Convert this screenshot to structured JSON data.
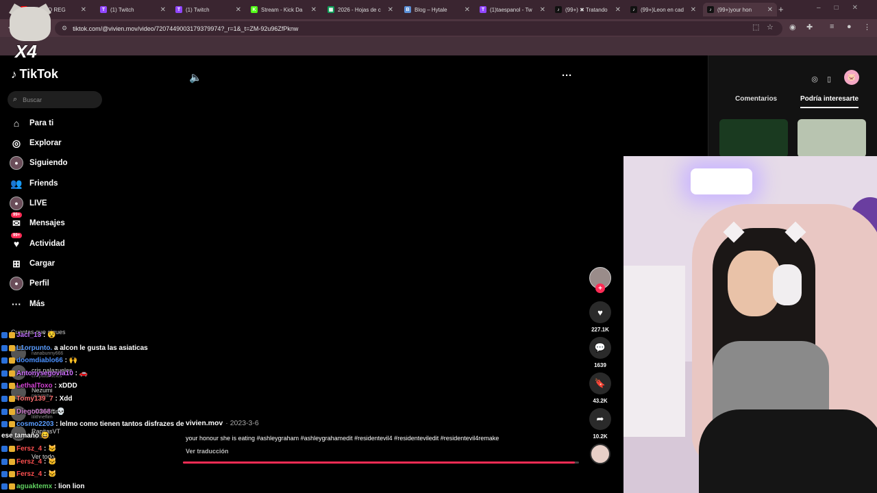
{
  "browser": {
    "tabs": [
      {
        "label": "(35) ¡NO REG",
        "icon": "youtube-icon",
        "color": "#ff0000",
        "glyph": "▶"
      },
      {
        "label": "(1) Twitch",
        "icon": "twitch-icon",
        "color": "#9146ff",
        "glyph": "T"
      },
      {
        "label": "(1) Twitch",
        "icon": "twitch-icon",
        "color": "#9146ff",
        "glyph": "T"
      },
      {
        "label": "Stream - Kick Da",
        "icon": "kick-icon",
        "color": "#53fc18",
        "glyph": "K"
      },
      {
        "label": "2026 - Hojas de c",
        "icon": "sheets-icon",
        "color": "#0f9d58",
        "glyph": "▦"
      },
      {
        "label": "Blog – Hytale",
        "icon": "hytale-icon",
        "color": "#5b8fd6",
        "glyph": "B"
      },
      {
        "label": "(1)taespanol - Tw",
        "icon": "twitch-icon",
        "color": "#9146ff",
        "glyph": "T"
      },
      {
        "label": "(99+) ✖ Tratando",
        "icon": "tiktok-icon",
        "color": "#111111",
        "glyph": "♪"
      },
      {
        "label": "(99+)Leon en cad",
        "icon": "tiktok-icon",
        "color": "#111111",
        "glyph": "♪"
      },
      {
        "label": "(99+)your hon",
        "icon": "tiktok-icon",
        "color": "#111111",
        "glyph": "♪"
      }
    ],
    "url": "tiktok.com/@vivien.mov/video/7207449003179379974?_r=1&_t=ZM-92u96ZfPknw",
    "overlay_multiplier": "X4"
  },
  "sidebar": {
    "logo": "TikTok",
    "search_placeholder": "Buscar",
    "nav": [
      {
        "label": "Para ti",
        "icon": "home-icon",
        "glyph": "⌂"
      },
      {
        "label": "Explorar",
        "icon": "compass-icon",
        "glyph": "◎"
      },
      {
        "label": "Siguiendo",
        "icon": "following-avatar-icon",
        "glyph": "●"
      },
      {
        "label": "Friends",
        "icon": "friends-icon",
        "glyph": "👥"
      },
      {
        "label": "LIVE",
        "icon": "live-icon",
        "glyph": "●"
      },
      {
        "label": "Mensajes",
        "icon": "messages-icon",
        "glyph": "✉",
        "badge": "99+"
      },
      {
        "label": "Actividad",
        "icon": "activity-icon",
        "glyph": "♥",
        "badge": "99+"
      },
      {
        "label": "Cargar",
        "icon": "upload-icon",
        "glyph": "⊞"
      },
      {
        "label": "Perfil",
        "icon": "profile-icon",
        "glyph": "●"
      },
      {
        "label": "Más",
        "icon": "more-icon",
        "glyph": "···"
      }
    ],
    "following_header": "Cuentas que sigues",
    "following": [
      {
        "name": "",
        "sub": "nanabunny666"
      },
      {
        "name": "cris.palazuelos",
        "sub": "crispalazuelos"
      },
      {
        "name": "Nezumi",
        "sub": "nezumitv"
      },
      {
        "name": "Lilithneflim",
        "sub": "lilithneflim"
      },
      {
        "name": "RapitasVT",
        "sub": "rapitasvt"
      }
    ],
    "see_all": "Ver todo"
  },
  "video": {
    "volume_icon": "volume-icon",
    "author": "vivien.mov",
    "date": "2023-3-6",
    "caption": "your honour she is eating #ashleygraham #ashleygrahamedit #residentevil4 #residenteviledit #residentevil4remake",
    "translate": "Ver traducción",
    "progress": 0.99,
    "likes": "227.1K",
    "comments": "1639",
    "saves": "43.2K",
    "shares": "10.2K"
  },
  "right_panel": {
    "tabs": [
      "Comentarios",
      "Podría interesarte"
    ],
    "active_tab": "Podría interesarte"
  },
  "chat": [
    {
      "user": "Jacl_13",
      "color": "#c070ff",
      "msg": ": 😵"
    },
    {
      "user": "L1orpunto.",
      "color": "#5a9dff",
      "msg": "a alcon le gusta las asiaticas"
    },
    {
      "user": "doomdiablo66",
      "color": "#4a90ff",
      "msg": ": 🙌"
    },
    {
      "user": "Antonysegovia10",
      "color": "#d070ff",
      "msg": ": 🚗"
    },
    {
      "user": "LethalToxo",
      "color": "#d040d0",
      "msg": ": xDDD"
    },
    {
      "user": "Tomy139_7",
      "color": "#ff7070",
      "msg": ": Xdd"
    },
    {
      "user": "Diego0368",
      "color": "#d080d0",
      "msg": ": 💀"
    },
    {
      "user": "cosmo2203",
      "color": "#5a9dff",
      "msg": ": lelmo como tienen tantos disfrazes de"
    },
    {
      "user": "",
      "color": "#ffffff",
      "msg": "ese tamaño 😆"
    },
    {
      "user": "Fersz_4",
      "color": "#ff5050",
      "msg": ": 🐱"
    },
    {
      "user": "Fersz_4",
      "color": "#ff5050",
      "msg": ": 🐱"
    },
    {
      "user": "Fersz_4",
      "color": "#ff5050",
      "msg": ": 🐱"
    },
    {
      "user": "aguaktemx",
      "color": "#60d060",
      "msg": ": lion lion"
    }
  ]
}
